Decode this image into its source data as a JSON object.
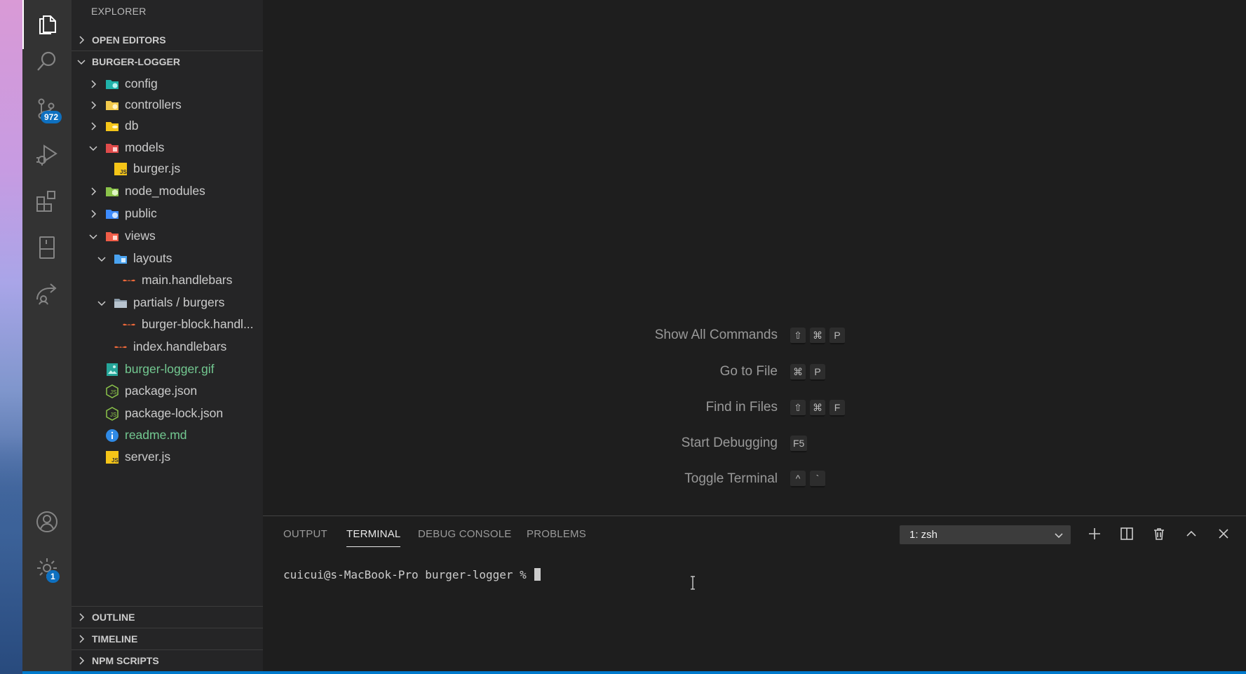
{
  "activity_bar": {
    "items": [
      {
        "name": "explorer",
        "active": true
      },
      {
        "name": "search"
      },
      {
        "name": "source-control",
        "badge": "972"
      },
      {
        "name": "run-debug"
      },
      {
        "name": "extensions"
      },
      {
        "name": "notebook"
      },
      {
        "name": "remote-share"
      }
    ],
    "bottom": [
      {
        "name": "accounts"
      },
      {
        "name": "manage",
        "badge": "1"
      }
    ]
  },
  "sidebar": {
    "title": "EXPLORER",
    "open_editors": "OPEN EDITORS",
    "project": "BURGER-LOGGER",
    "tree": [
      {
        "label": "config",
        "chev": "right",
        "icon": "folder-config"
      },
      {
        "label": "controllers",
        "chev": "right",
        "icon": "folder-controllers"
      },
      {
        "label": "db",
        "chev": "right",
        "icon": "folder-db"
      },
      {
        "label": "models",
        "chev": "down",
        "icon": "folder-models"
      },
      {
        "label": "burger.js",
        "icon": "js-file"
      },
      {
        "label": "node_modules",
        "chev": "right",
        "icon": "folder-node"
      },
      {
        "label": "public",
        "chev": "right",
        "icon": "folder-public"
      },
      {
        "label": "views",
        "chev": "down",
        "icon": "folder-views"
      },
      {
        "label": "layouts",
        "chev": "down",
        "icon": "folder-layouts"
      },
      {
        "label": "main.handlebars",
        "icon": "handlebars-file"
      },
      {
        "label": "partials / burgers",
        "chev": "down",
        "icon": "folder-partials"
      },
      {
        "label": "burger-block.handl...",
        "icon": "handlebars-file"
      },
      {
        "label": "index.handlebars",
        "icon": "handlebars-file"
      },
      {
        "label": "burger-logger.gif",
        "icon": "image-file",
        "git": "U"
      },
      {
        "label": "package.json",
        "icon": "json-file"
      },
      {
        "label": "package-lock.json",
        "icon": "json-file"
      },
      {
        "label": "readme.md",
        "icon": "info-file",
        "git": "U"
      },
      {
        "label": "server.js",
        "icon": "js-file"
      }
    ],
    "outline": "OUTLINE",
    "timeline": "TIMELINE",
    "npm_scripts": "NPM SCRIPTS"
  },
  "editor_hints": [
    {
      "label": "Show All Commands",
      "keys": [
        "⇧",
        "⌘",
        "P"
      ]
    },
    {
      "label": "Go to File",
      "keys": [
        "⌘",
        "P"
      ]
    },
    {
      "label": "Find in Files",
      "keys": [
        "⇧",
        "⌘",
        "F"
      ]
    },
    {
      "label": "Start Debugging",
      "keys": [
        "F5"
      ]
    },
    {
      "label": "Toggle Terminal",
      "keys": [
        "^",
        "`"
      ]
    }
  ],
  "panel": {
    "tabs": [
      "OUTPUT",
      "TERMINAL",
      "DEBUG CONSOLE",
      "PROBLEMS"
    ],
    "active_tab": "TERMINAL",
    "terminal_select": "1: zsh",
    "prompt": "cuicui@s-MacBook-Pro burger-logger % "
  },
  "colors": {
    "accent": "#007acc",
    "git_untracked": "#73c991",
    "badge": "#0e70c0"
  }
}
